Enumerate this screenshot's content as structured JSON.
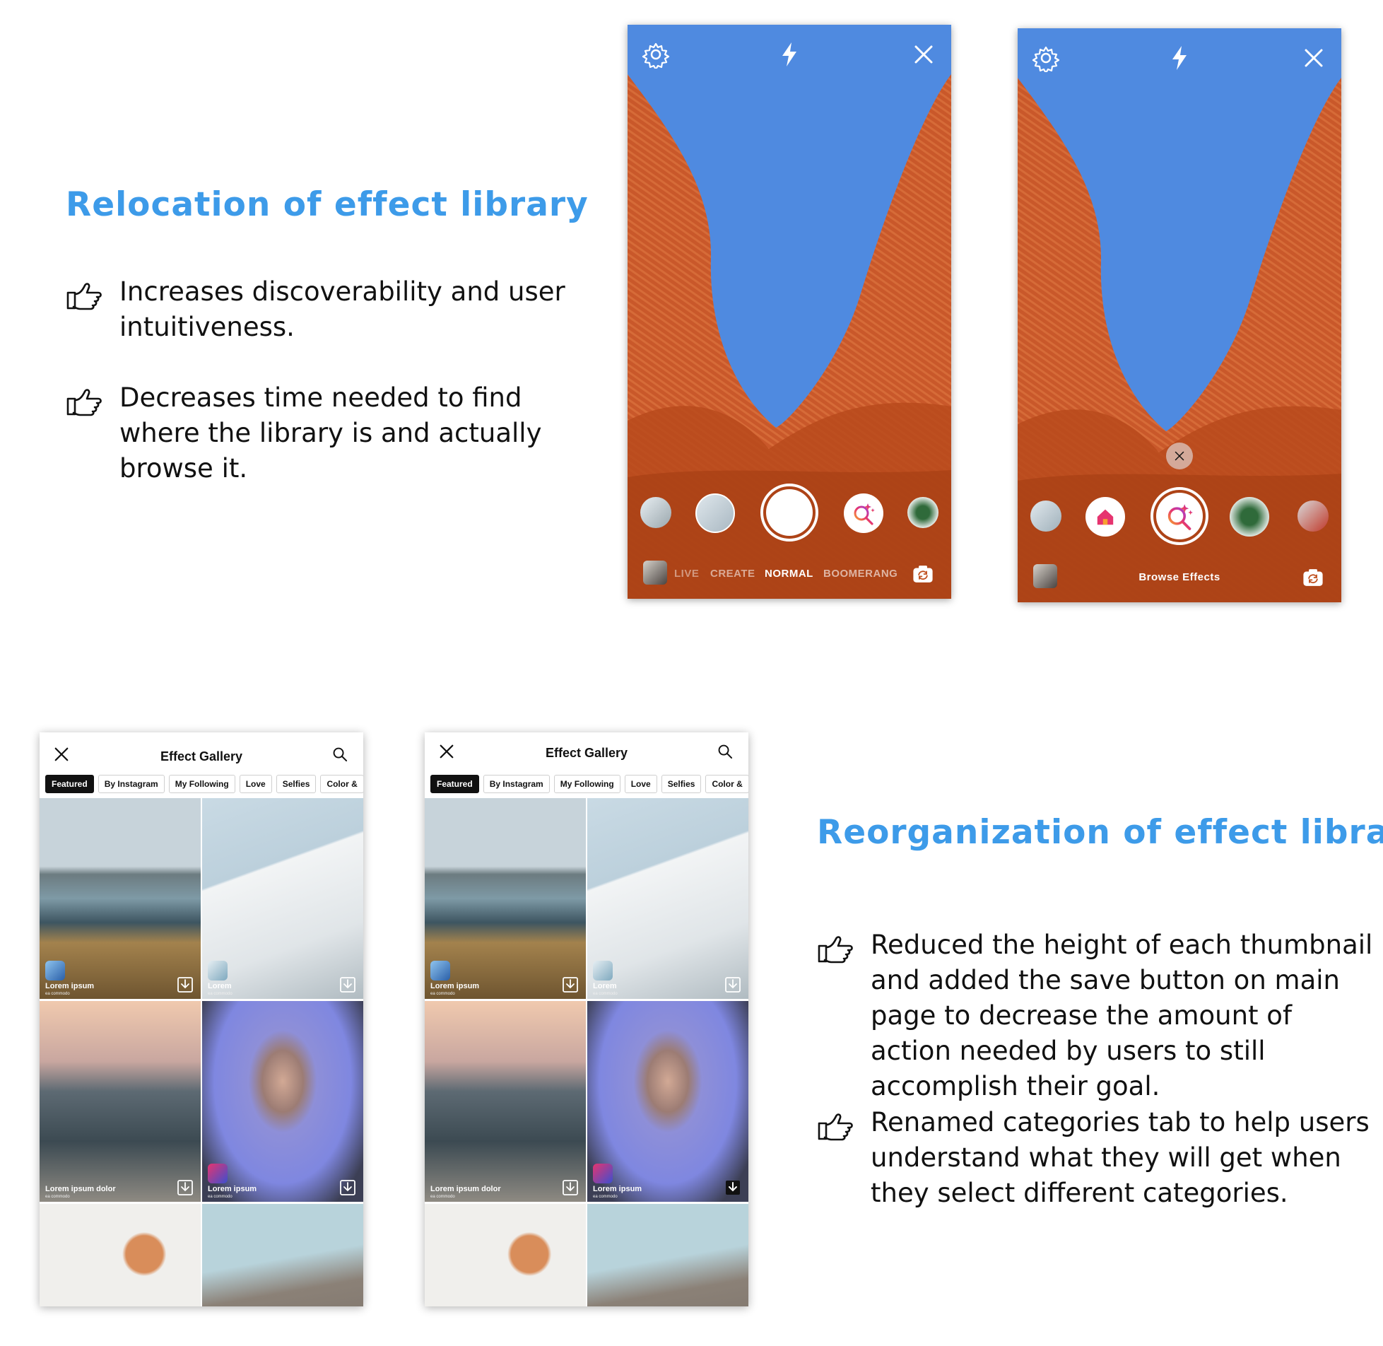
{
  "section1": {
    "heading": "Relocation of effect library",
    "bullets": [
      "Increases discoverability and user intuitiveness.",
      "Decreases time needed to find where the library is and actually browse it."
    ]
  },
  "section2": {
    "heading": "Reorganization of effect library",
    "bullets": [
      "Reduced the height of each thumbnail and added the save button on main page to decrease the amount of action needed by users to still accomplish their goal.",
      "Renamed categories tab to help users understand what they will get when they select different categories."
    ]
  },
  "camera1": {
    "modes": [
      "LIVE",
      "CREATE",
      "NORMAL",
      "BOOMERANG"
    ],
    "active_mode": "NORMAL"
  },
  "camera2": {
    "browse_label": "Browse Effects"
  },
  "gallery": {
    "title": "Effect Gallery",
    "tabs": [
      "Featured",
      "By Instagram",
      "My Following",
      "Love",
      "Selfies",
      "Color &"
    ],
    "active_tab": "Featured",
    "cells": [
      {
        "label": "Lorem ipsum",
        "sub": "ea commodo"
      },
      {
        "label": "Lorem",
        "sub": "ea commodo"
      },
      {
        "label": "Lorem ipsum dolor",
        "sub": "ea commodo"
      },
      {
        "label": "Lorem ipsum",
        "sub": "ea commodo"
      }
    ]
  },
  "colors": {
    "accent": "#3d9be9",
    "sky": "#4f8ae0",
    "facade": "#c0501f"
  },
  "icons": [
    "pointing-hand-icon",
    "gear-icon",
    "flash-icon",
    "close-icon",
    "search-icon",
    "download-icon",
    "flip-camera-icon",
    "sparkle-search-icon",
    "home-icon"
  ]
}
